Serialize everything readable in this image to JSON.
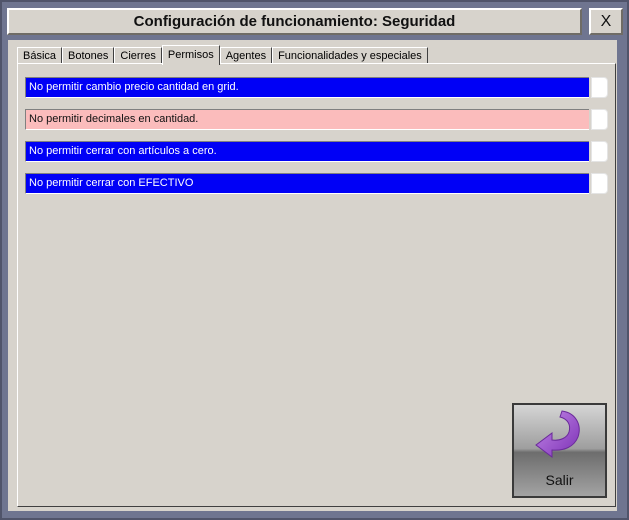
{
  "window": {
    "title": "Configuración de funcionamiento: Seguridad",
    "close_label": "X"
  },
  "tabs": [
    {
      "label": "Básica",
      "active": false
    },
    {
      "label": "Botones",
      "active": false
    },
    {
      "label": "Cierres",
      "active": false
    },
    {
      "label": "Permisos",
      "active": true
    },
    {
      "label": "Agentes",
      "active": false
    },
    {
      "label": "Funcionalidades y especiales",
      "active": false
    }
  ],
  "permissions": [
    {
      "label": "No permitir cambio precio cantidad en grid.",
      "color": "#0000f6"
    },
    {
      "label": "No permitir decimales en cantidad.",
      "color": "#fbbcbc"
    },
    {
      "label": "No permitir cerrar con artículos a cero.",
      "color": "#0000f6"
    },
    {
      "label": "No permitir cerrar con EFECTIVO",
      "color": "#0000f6"
    }
  ],
  "exit_button": {
    "label": "Salir",
    "icon": "curved-arrow-return-icon",
    "icon_color": "#9a4fd0"
  }
}
